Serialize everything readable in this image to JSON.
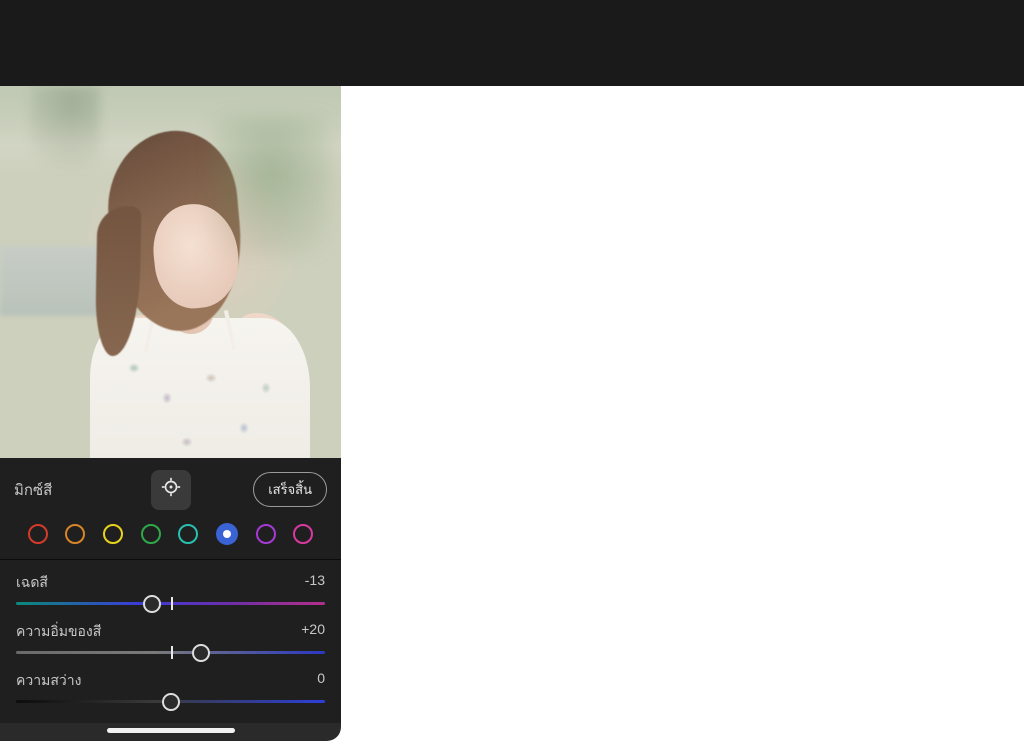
{
  "header": {
    "present": true
  },
  "panel": {
    "title": "มิกซ์สี",
    "done_label": "เสร็จสิ้น"
  },
  "colors": {
    "items": [
      {
        "name": "red",
        "hex": "#d43a2a",
        "selected": false
      },
      {
        "name": "orange",
        "hex": "#d8852a",
        "selected": false
      },
      {
        "name": "yellow",
        "hex": "#e7d31e",
        "selected": false
      },
      {
        "name": "green",
        "hex": "#2fa84a",
        "selected": false
      },
      {
        "name": "aqua",
        "hex": "#27c0b0",
        "selected": false
      },
      {
        "name": "blue",
        "hex": "#3a63d6",
        "selected": true
      },
      {
        "name": "purple",
        "hex": "#a63ad6",
        "selected": false
      },
      {
        "name": "magenta",
        "hex": "#d63aa0",
        "selected": false
      }
    ]
  },
  "sliders": {
    "hue": {
      "label": "เฉดสี",
      "value": "-13",
      "pos": 44,
      "tick": 50
    },
    "saturation": {
      "label": "ความอิ่มของสี",
      "value": "+20",
      "pos": 60,
      "tick": 50
    },
    "luminance": {
      "label": "ความสว่าง",
      "value": "0",
      "pos": 50,
      "tick": 50
    }
  }
}
